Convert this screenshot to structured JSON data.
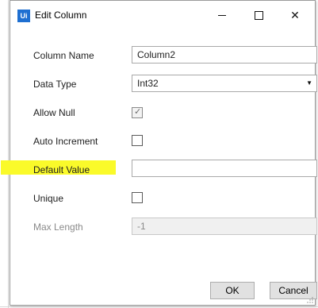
{
  "window": {
    "app_icon_text": "Ui",
    "title": "Edit Column",
    "controls": {
      "minimize_icon": "minimize-icon",
      "maximize_icon": "maximize-icon",
      "close_icon": "close-icon",
      "close_glyph": "✕"
    }
  },
  "form": {
    "column_name": {
      "label": "Column Name",
      "value": "Column2"
    },
    "data_type": {
      "label": "Data Type",
      "value": "Int32",
      "arrow_glyph": "▼"
    },
    "allow_null": {
      "label": "Allow Null",
      "checked": true,
      "check_glyph": "✓"
    },
    "auto_increment": {
      "label": "Auto Increment",
      "checked": false
    },
    "default_value": {
      "label": "Default Value",
      "value": "",
      "highlight_color": "#fafa2a"
    },
    "unique": {
      "label": "Unique",
      "checked": false
    },
    "max_length": {
      "label": "Max Length",
      "value": "-1",
      "disabled": true
    }
  },
  "buttons": {
    "ok": "OK",
    "cancel": "Cancel"
  },
  "colors": {
    "accent": "#1e6fd1",
    "button_bg": "#e1e1e1"
  }
}
